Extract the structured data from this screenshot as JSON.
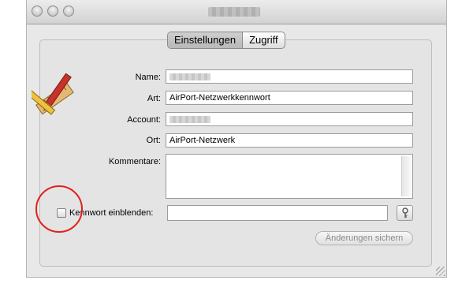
{
  "tabs": [
    "Einstellungen",
    "Zugriff"
  ],
  "form": {
    "name_label": "Name:",
    "art_label": "Art:",
    "art_value": "AirPort-Netzwerkkennwort",
    "account_label": "Account:",
    "ort_label": "Ort:",
    "ort_value": "AirPort-Netzwerk",
    "kommentare_label": "Kommentare:",
    "show_password_label": "Kennwort einblenden:",
    "save_button": "Änderungen sichern",
    "show_password_checked": false
  },
  "icons": {
    "app": "pencil-ruler-icon",
    "key": "key-icon"
  },
  "colors": {
    "highlight_circle": "#e0211d"
  }
}
